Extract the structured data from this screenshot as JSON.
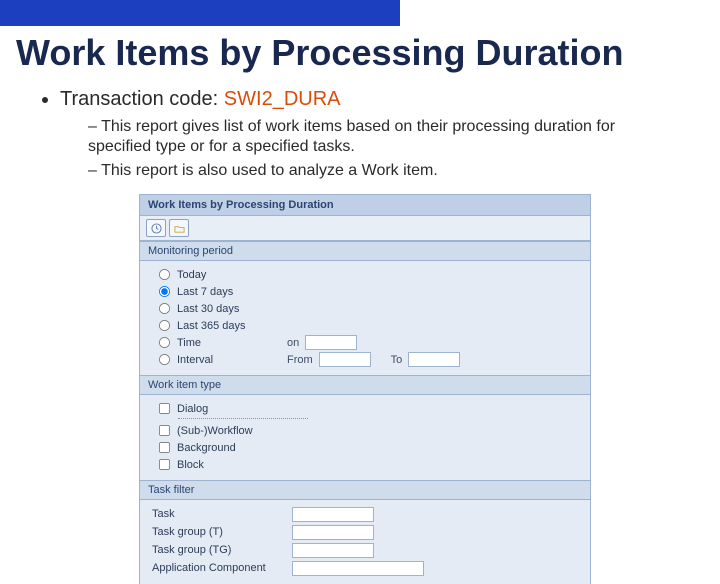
{
  "slide": {
    "title": "Work Items by Processing Duration",
    "bullet_label": "Transaction code:",
    "tcode": "SWI2_DURA",
    "sub1": "This report gives list of work items based on their processing duration for specified type or for a specified tasks.",
    "sub2": "This report is also used to analyze a Work item."
  },
  "sap": {
    "title": "Work Items by Processing Duration",
    "monitoring": {
      "header": "Monitoring period",
      "today": "Today",
      "last7": "Last 7 days",
      "last30": "Last 30 days",
      "last365": "Last 365 days",
      "time": "Time",
      "on": "on",
      "interval": "Interval",
      "from": "From",
      "to": "To"
    },
    "witype": {
      "header": "Work item type",
      "dialog": "Dialog",
      "subwf": "(Sub-)Workflow",
      "background": "Background",
      "block": "Block"
    },
    "filter": {
      "header": "Task filter",
      "task": "Task",
      "tg_t": "Task group (T)",
      "tg_tg": "Task group (TG)",
      "appcomp": "Application Component"
    }
  }
}
